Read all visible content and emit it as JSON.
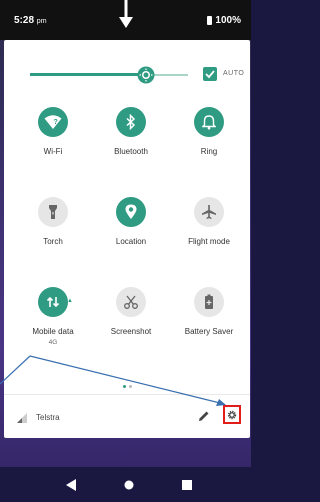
{
  "status_bar": {
    "time": "5:28",
    "time_suffix": "pm",
    "battery": "100%"
  },
  "brightness": {
    "level_fraction": 0.72,
    "auto_label": "AUTO",
    "auto_checked": true
  },
  "tiles": [
    {
      "label": "Wi-Fi",
      "icon": "wifi-icon",
      "on": true
    },
    {
      "label": "Bluetooth",
      "icon": "bluetooth-icon",
      "on": true
    },
    {
      "label": "Ring",
      "icon": "bell-icon",
      "on": true
    },
    {
      "label": "Torch",
      "icon": "flashlight-icon",
      "on": false
    },
    {
      "label": "Location",
      "icon": "location-pin-icon",
      "on": true
    },
    {
      "label": "Flight mode",
      "icon": "airplane-icon",
      "on": false
    },
    {
      "label": "Mobile data",
      "sub": "4G",
      "icon": "mobile-data-icon",
      "on": true
    },
    {
      "label": "Screenshot",
      "icon": "screenshot-icon",
      "on": false
    },
    {
      "label": "Battery Saver",
      "icon": "battery-icon",
      "on": false
    }
  ],
  "footer": {
    "carrier": "Telstra"
  },
  "colors": {
    "accent": "#2f9b82",
    "highlight": "#e21b1b",
    "pointer": "#3a6fb0"
  }
}
